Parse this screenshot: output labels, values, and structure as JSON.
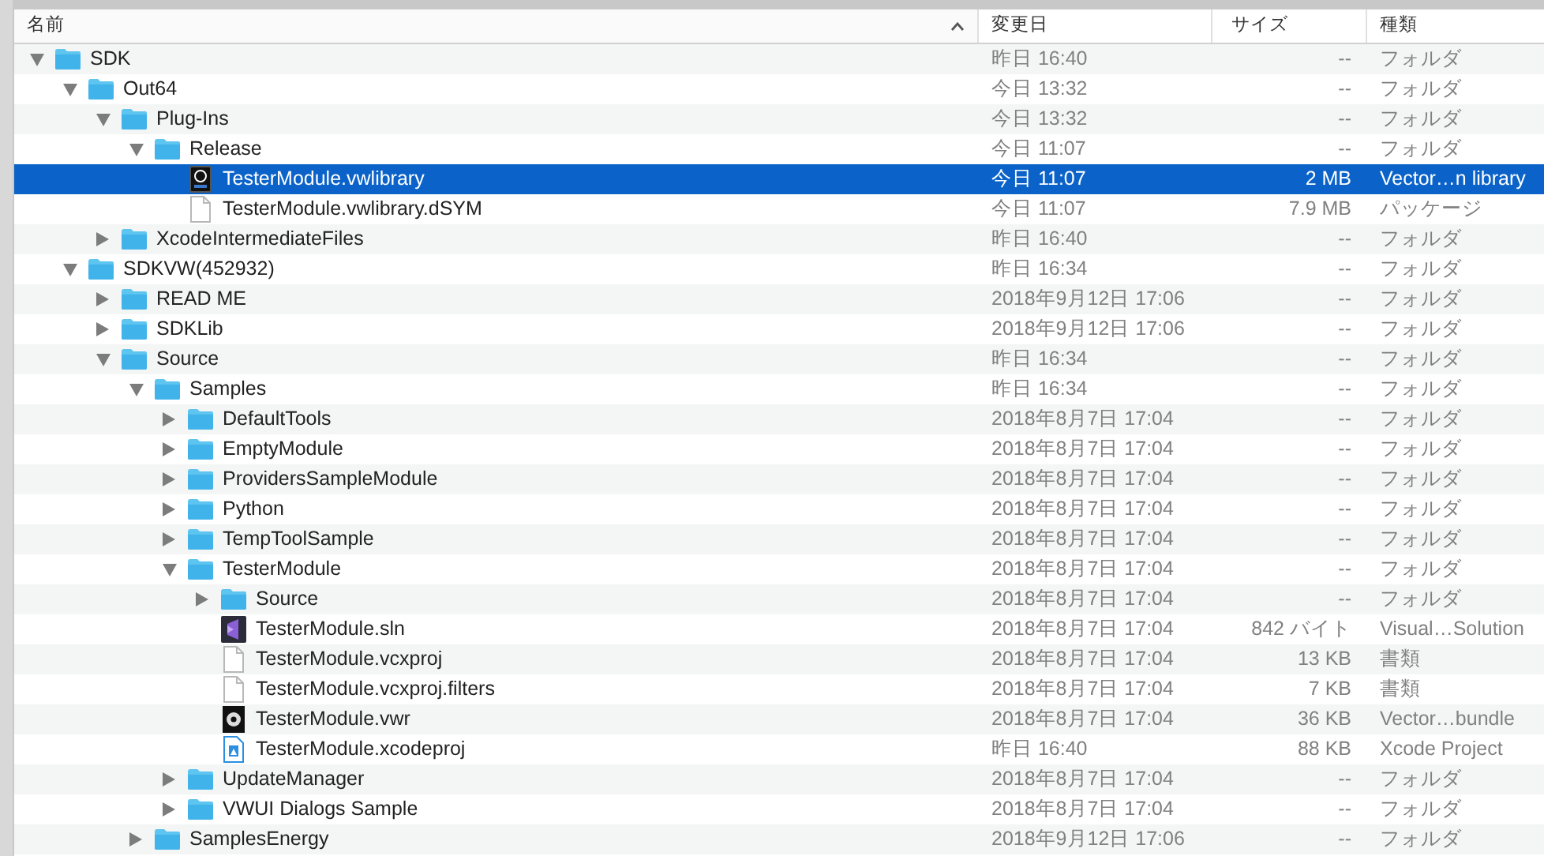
{
  "columns": [
    {
      "label": "名前",
      "sorted": true
    },
    {
      "label": "変更日",
      "sorted": false
    },
    {
      "label": "サイズ",
      "sorted": false
    },
    {
      "label": "種類",
      "sorted": false
    }
  ],
  "tree": [
    {
      "name": "SDK",
      "kind": "folder",
      "expanded": true,
      "selected": false,
      "date": "昨日 16:40",
      "size": "--",
      "type": "フォルダ",
      "children": [
        {
          "name": "Out64",
          "kind": "folder",
          "expanded": true,
          "selected": false,
          "date": "今日 13:32",
          "size": "--",
          "type": "フォルダ",
          "children": [
            {
              "name": "Plug-Ins",
              "kind": "folder",
              "expanded": true,
              "selected": false,
              "date": "今日 13:32",
              "size": "--",
              "type": "フォルダ",
              "children": [
                {
                  "name": "Release",
                  "kind": "folder",
                  "expanded": true,
                  "selected": false,
                  "date": "今日 11:07",
                  "size": "--",
                  "type": "フォルダ",
                  "children": [
                    {
                      "name": "TesterModule.vwlibrary",
                      "kind": "vwlibrary",
                      "selected": true,
                      "date": "今日 11:07",
                      "size": "2 MB",
                      "type": "Vector…n library"
                    },
                    {
                      "name": "TesterModule.vwlibrary.dSYM",
                      "kind": "doc",
                      "selected": false,
                      "date": "今日 11:07",
                      "size": "7.9 MB",
                      "type": "パッケージ"
                    }
                  ]
                }
              ]
            },
            {
              "name": "XcodeIntermediateFiles",
              "kind": "folder",
              "expanded": false,
              "selected": false,
              "date": "昨日 16:40",
              "size": "--",
              "type": "フォルダ"
            }
          ]
        },
        {
          "name": "SDKVW(452932)",
          "kind": "folder",
          "expanded": true,
          "selected": false,
          "date": "昨日 16:34",
          "size": "--",
          "type": "フォルダ",
          "children": [
            {
              "name": "READ ME",
              "kind": "folder",
              "expanded": false,
              "selected": false,
              "date": "2018年9月12日 17:06",
              "size": "--",
              "type": "フォルダ"
            },
            {
              "name": "SDKLib",
              "kind": "folder",
              "expanded": false,
              "selected": false,
              "date": "2018年9月12日 17:06",
              "size": "--",
              "type": "フォルダ"
            },
            {
              "name": "Source",
              "kind": "folder",
              "expanded": true,
              "selected": false,
              "date": "昨日 16:34",
              "size": "--",
              "type": "フォルダ",
              "children": [
                {
                  "name": "Samples",
                  "kind": "folder",
                  "expanded": true,
                  "selected": false,
                  "date": "昨日 16:34",
                  "size": "--",
                  "type": "フォルダ",
                  "children": [
                    {
                      "name": "DefaultTools",
                      "kind": "folder",
                      "expanded": false,
                      "selected": false,
                      "date": "2018年8月7日 17:04",
                      "size": "--",
                      "type": "フォルダ"
                    },
                    {
                      "name": "EmptyModule",
                      "kind": "folder",
                      "expanded": false,
                      "selected": false,
                      "date": "2018年8月7日 17:04",
                      "size": "--",
                      "type": "フォルダ"
                    },
                    {
                      "name": "ProvidersSampleModule",
                      "kind": "folder",
                      "expanded": false,
                      "selected": false,
                      "date": "2018年8月7日 17:04",
                      "size": "--",
                      "type": "フォルダ"
                    },
                    {
                      "name": "Python",
                      "kind": "folder",
                      "expanded": false,
                      "selected": false,
                      "date": "2018年8月7日 17:04",
                      "size": "--",
                      "type": "フォルダ"
                    },
                    {
                      "name": "TempToolSample",
                      "kind": "folder",
                      "expanded": false,
                      "selected": false,
                      "date": "2018年8月7日 17:04",
                      "size": "--",
                      "type": "フォルダ"
                    },
                    {
                      "name": "TesterModule",
                      "kind": "folder",
                      "expanded": true,
                      "selected": false,
                      "date": "2018年8月7日 17:04",
                      "size": "--",
                      "type": "フォルダ",
                      "children": [
                        {
                          "name": "Source",
                          "kind": "folder",
                          "expanded": false,
                          "selected": false,
                          "date": "2018年8月7日 17:04",
                          "size": "--",
                          "type": "フォルダ"
                        },
                        {
                          "name": "TesterModule.sln",
                          "kind": "sln",
                          "selected": false,
                          "date": "2018年8月7日 17:04",
                          "size": "842 バイト",
                          "type": "Visual…Solution"
                        },
                        {
                          "name": "TesterModule.vcxproj",
                          "kind": "doc",
                          "selected": false,
                          "date": "2018年8月7日 17:04",
                          "size": "13 KB",
                          "type": "書類"
                        },
                        {
                          "name": "TesterModule.vcxproj.filters",
                          "kind": "doc",
                          "selected": false,
                          "date": "2018年8月7日 17:04",
                          "size": "7 KB",
                          "type": "書類"
                        },
                        {
                          "name": "TesterModule.vwr",
                          "kind": "vwr",
                          "selected": false,
                          "date": "2018年8月7日 17:04",
                          "size": "36 KB",
                          "type": "Vector…bundle"
                        },
                        {
                          "name": "TesterModule.xcodeproj",
                          "kind": "xcodeproj",
                          "selected": false,
                          "date": "昨日 16:40",
                          "size": "88 KB",
                          "type": "Xcode Project"
                        }
                      ]
                    },
                    {
                      "name": "UpdateManager",
                      "kind": "folder",
                      "expanded": false,
                      "selected": false,
                      "date": "2018年8月7日 17:04",
                      "size": "--",
                      "type": "フォルダ"
                    },
                    {
                      "name": "VWUI Dialogs Sample",
                      "kind": "folder",
                      "expanded": false,
                      "selected": false,
                      "date": "2018年8月7日 17:04",
                      "size": "--",
                      "type": "フォルダ"
                    }
                  ]
                },
                {
                  "name": "SamplesEnergy",
                  "kind": "folder",
                  "expanded": false,
                  "selected": false,
                  "date": "2018年9月12日 17:06",
                  "size": "--",
                  "type": "フォルダ"
                }
              ]
            }
          ]
        }
      ]
    }
  ]
}
